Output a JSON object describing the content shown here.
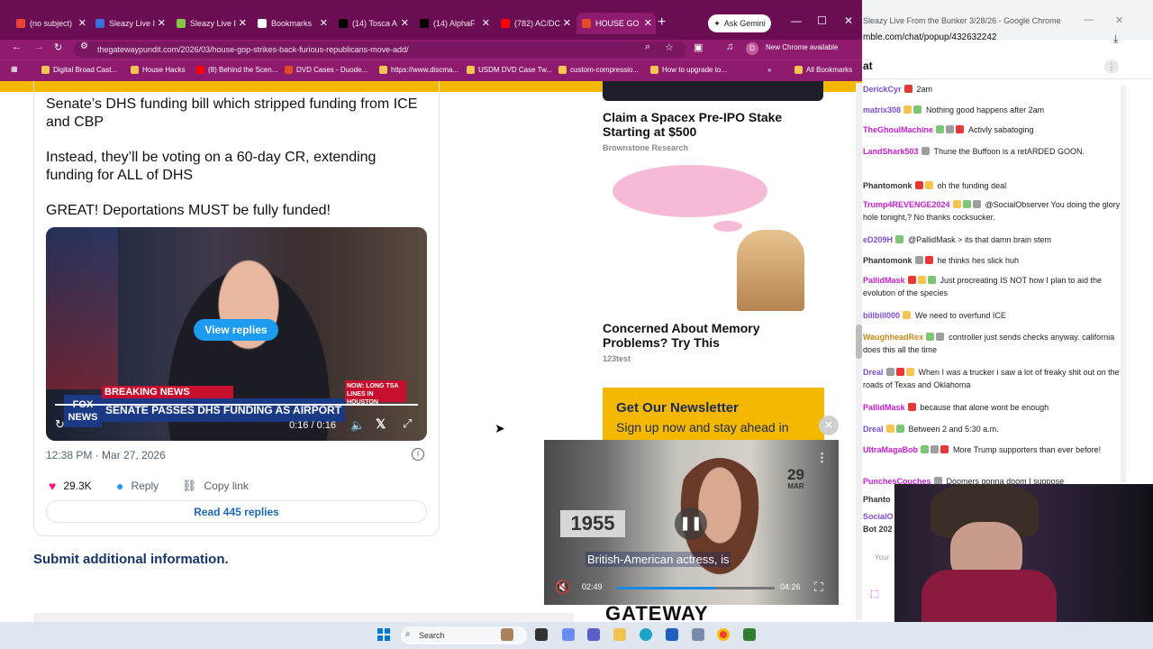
{
  "browser": {
    "tabs": [
      {
        "label": "(no subject)",
        "icon": "gmail-icon",
        "color": "#ea4335"
      },
      {
        "label": "Sleazy Live I",
        "icon": "rumble-r-icon",
        "color": "#3b6fe0"
      },
      {
        "label": "Sleazy Live I",
        "icon": "rumble-play-icon",
        "color": "#85c742"
      },
      {
        "label": "Bookmarks",
        "icon": "star-icon",
        "color": "#ffffff"
      },
      {
        "label": "(14) Tosca A",
        "icon": "x-icon",
        "color": "#000000"
      },
      {
        "label": "(14) AlphaF",
        "icon": "x-icon",
        "color": "#000000"
      },
      {
        "label": "(782) AC/DC",
        "icon": "youtube-icon",
        "color": "#ff0000"
      },
      {
        "label": "HOUSE GO",
        "icon": "gateway-icon",
        "color": "#e34a25"
      }
    ],
    "new_tab": "+",
    "gemini_label": "Ask Gemini",
    "url": "thegatewaypundit.com/2026/03/house-gop-strikes-back-furious-republicans-move-add/",
    "new_chrome_label": "New Chrome available",
    "profile_initial": "D",
    "bookmarks": [
      "Digital Broad Cast...",
      "House Hacks",
      "(8) Behind the Scen...",
      "DVD Cases - Duode...",
      "https://www.discma...",
      "USDM DVD Case Tw...",
      "custom-compressio...",
      "How to upgrade to..."
    ],
    "all_bookmarks": "All Bookmarks"
  },
  "tweet": {
    "line1": "Senate’s DHS funding bill which stripped funding from ICE",
    "line2": "and CBP",
    "line3": "Instead, they’ll be voting on a 60-day CR, extending",
    "line4": "funding for ALL of DHS",
    "line5": "GREAT! Deportations MUST be fully funded!",
    "video": {
      "view_replies": "View replies",
      "breaking": "BREAKING NEWS",
      "chyron": "SENATE PASSES DHS FUNDING AS AIRPORT CHAOS SPIRALS",
      "side_banner": "NOW: LONG TSA LINES IN HOUSTON",
      "network": "FOX NEWS",
      "time": "0:16 / 0:16"
    },
    "date": "12:38 PM · Mar 27, 2026",
    "likes": "29.3K",
    "reply": "Reply",
    "copy_link": "Copy link",
    "read_replies": "Read 445 replies"
  },
  "submit_info": "Submit additional information.",
  "ads": [
    {
      "title": "Claim a Spacex Pre-IPO Stake Starting at $500",
      "source": "Brownstone Research"
    },
    {
      "title": "Concerned About Memory Problems? Try This",
      "source": "123test"
    }
  ],
  "newsletter": {
    "heading": "Get Our Newsletter",
    "sub": "Sign up now and stay ahead in"
  },
  "site_logo": "GATEWAY",
  "pip": {
    "year": "1955",
    "day": "29",
    "month": "MAR",
    "caption": "British-American actress, is",
    "elapsed": "02:49",
    "duration": "04:26",
    "progress": 0.63
  },
  "chat_window": {
    "title": "Sleazy Live From the Bunker 3/28/26 - Google Chrome",
    "url": "mble.com/chat/popup/432632242",
    "header": "at",
    "messages": [
      {
        "user": "DerickCyr",
        "color": "#7d4cd8",
        "text": "2am"
      },
      {
        "user": "matrix308",
        "color": "#7d4cd8",
        "text": "Nothing good happens after 2am"
      },
      {
        "user": "TheGhoulMachine",
        "color": "#c71ed2",
        "text": "Activly sabatoging"
      },
      {
        "user": "LandShark503",
        "color": "#c71ed2",
        "text": "Thune the Buffoon is a retARDED GOON."
      },
      {
        "user": "Phantomonk",
        "color": "#333333",
        "text": "oh the funding deal"
      },
      {
        "user": "Trump4REVENGE2024",
        "color": "#c71ed2",
        "text": "@SocialObserver You doing the glory hole tonight,? No thanks cocksucker."
      },
      {
        "user": "eD209H",
        "color": "#7d4cd8",
        "text": "@PallidMask > its that damn brain stem"
      },
      {
        "user": "Phantomonk",
        "color": "#333333",
        "text": "he thinks hes slick huh"
      },
      {
        "user": "PallidMask",
        "color": "#c71ed2",
        "text": "Just procreating IS NOT how I plan to aid the evolution of the species"
      },
      {
        "user": "billbill000",
        "color": "#7d4cd8",
        "text": "We need to overfund ICE"
      },
      {
        "user": "WaughheadRex",
        "color": "#c98a16",
        "text": "controller just sends checks anyway. california does this all the time"
      },
      {
        "user": "Dreal",
        "color": "#7d4cd8",
        "text": "When I was a trucker i saw a lot of freaky shit out on the roads of Texas and Oklahoma"
      },
      {
        "user": "PallidMask",
        "color": "#c71ed2",
        "text": "because that alone wont be enough"
      },
      {
        "user": "Dreal",
        "color": "#7d4cd8",
        "text": "Between 2 and 5:30 a.m."
      },
      {
        "user": "UltraMagaBob",
        "color": "#c71ed2",
        "text": "More Trump supporters than ever before!"
      },
      {
        "user": "PunchesCouches",
        "color": "#c71ed2",
        "text": "Doomers gonna doom I suppose"
      }
    ],
    "partial_names": [
      "Phanto",
      "SocialO",
      "Bot 202"
    ],
    "input_stub": "Your"
  },
  "taskbar": {
    "search": "Search"
  }
}
